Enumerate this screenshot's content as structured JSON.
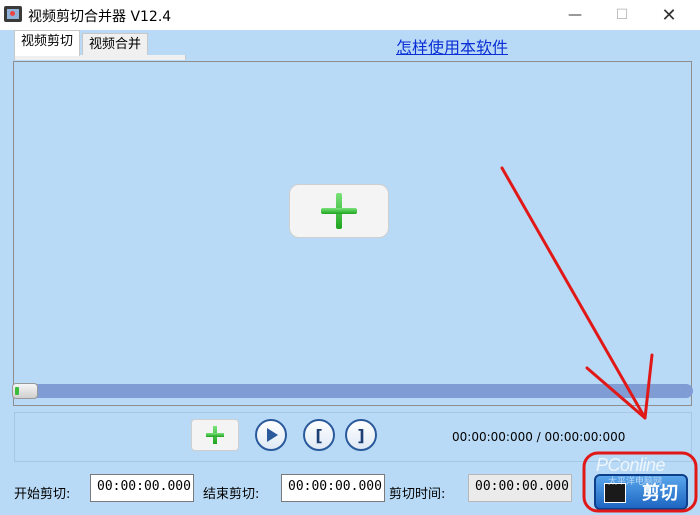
{
  "window": {
    "title": "视频剪切合并器 V12.4",
    "minimize_glyph": "—",
    "maximize_glyph": "☐",
    "close_glyph": "✕"
  },
  "tabs": [
    {
      "label": "视频剪切",
      "active": true
    },
    {
      "label": "视频合并",
      "active": false
    }
  ],
  "help_link": "怎样使用本软件",
  "controls": {
    "mark_in_glyph": "[",
    "mark_out_glyph": "]",
    "time_readout": "00:00:00:000 / 00:00:00:000"
  },
  "cut_settings": {
    "start_label": "开始剪切:",
    "start_value": "00:00:00.000",
    "end_label": "结束剪切:",
    "end_value": "00:00:00.000",
    "duration_label": "剪切时间:",
    "duration_value": "00:00:00.000"
  },
  "cut_button_label": "剪切",
  "watermark": {
    "brand": "PConline",
    "sub": "太平洋电脑网"
  },
  "colors": {
    "client_bg": "#b9daf6",
    "link": "#0a2fd6",
    "progress": "#7f9cd4",
    "accent_green": "#1ea41e",
    "annotation_red": "#e01818"
  },
  "progress": {
    "position_fraction": 0.0
  }
}
